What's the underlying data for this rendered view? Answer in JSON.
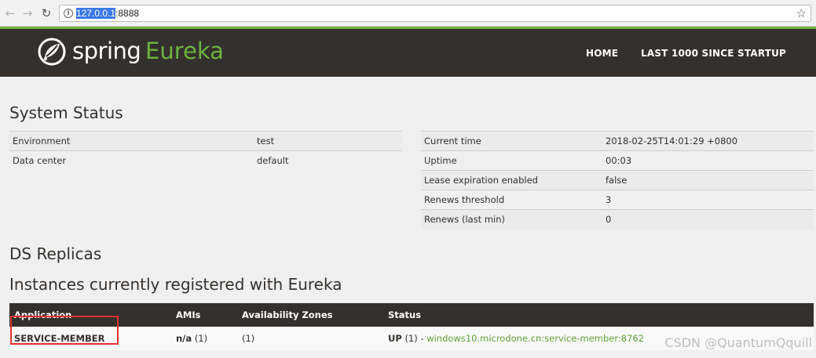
{
  "browser": {
    "url_selected": "127.0.0.1",
    "url_rest": ":8888",
    "icons": [
      "back-arrow-icon",
      "forward-arrow-icon",
      "reload-icon",
      "info-icon",
      "star-icon"
    ]
  },
  "header": {
    "brand_spring": "spring",
    "brand_eureka": "Eureka",
    "nav": {
      "home": "HOME",
      "last": "LAST 1000 SINCE STARTUP"
    },
    "colors": {
      "bar": "#34302d",
      "accent": "#6db33f"
    }
  },
  "system_status": {
    "title": "System Status",
    "left": [
      {
        "key": "Environment",
        "value": "test"
      },
      {
        "key": "Data center",
        "value": "default"
      }
    ],
    "right": [
      {
        "key": "Current time",
        "value": "2018-02-25T14:01:29 +0800"
      },
      {
        "key": "Uptime",
        "value": "00:03"
      },
      {
        "key": "Lease expiration enabled",
        "value": "false"
      },
      {
        "key": "Renews threshold",
        "value": "3"
      },
      {
        "key": "Renews (last min)",
        "value": "0"
      }
    ]
  },
  "ds_replicas": {
    "title": "DS Replicas"
  },
  "instances": {
    "title": "Instances currently registered with Eureka",
    "headers": [
      "Application",
      "AMIs",
      "Availability Zones",
      "Status"
    ],
    "rows": [
      {
        "application": "SERVICE-MEMBER",
        "amis_value": "n/a",
        "amis_count": "(1)",
        "zones": "(1)",
        "status": "UP",
        "status_count": "(1) -",
        "instance_link": "windows10.microdone.cn:service-member:8762"
      }
    ]
  },
  "watermark": "CSDN @QuantumQquill"
}
